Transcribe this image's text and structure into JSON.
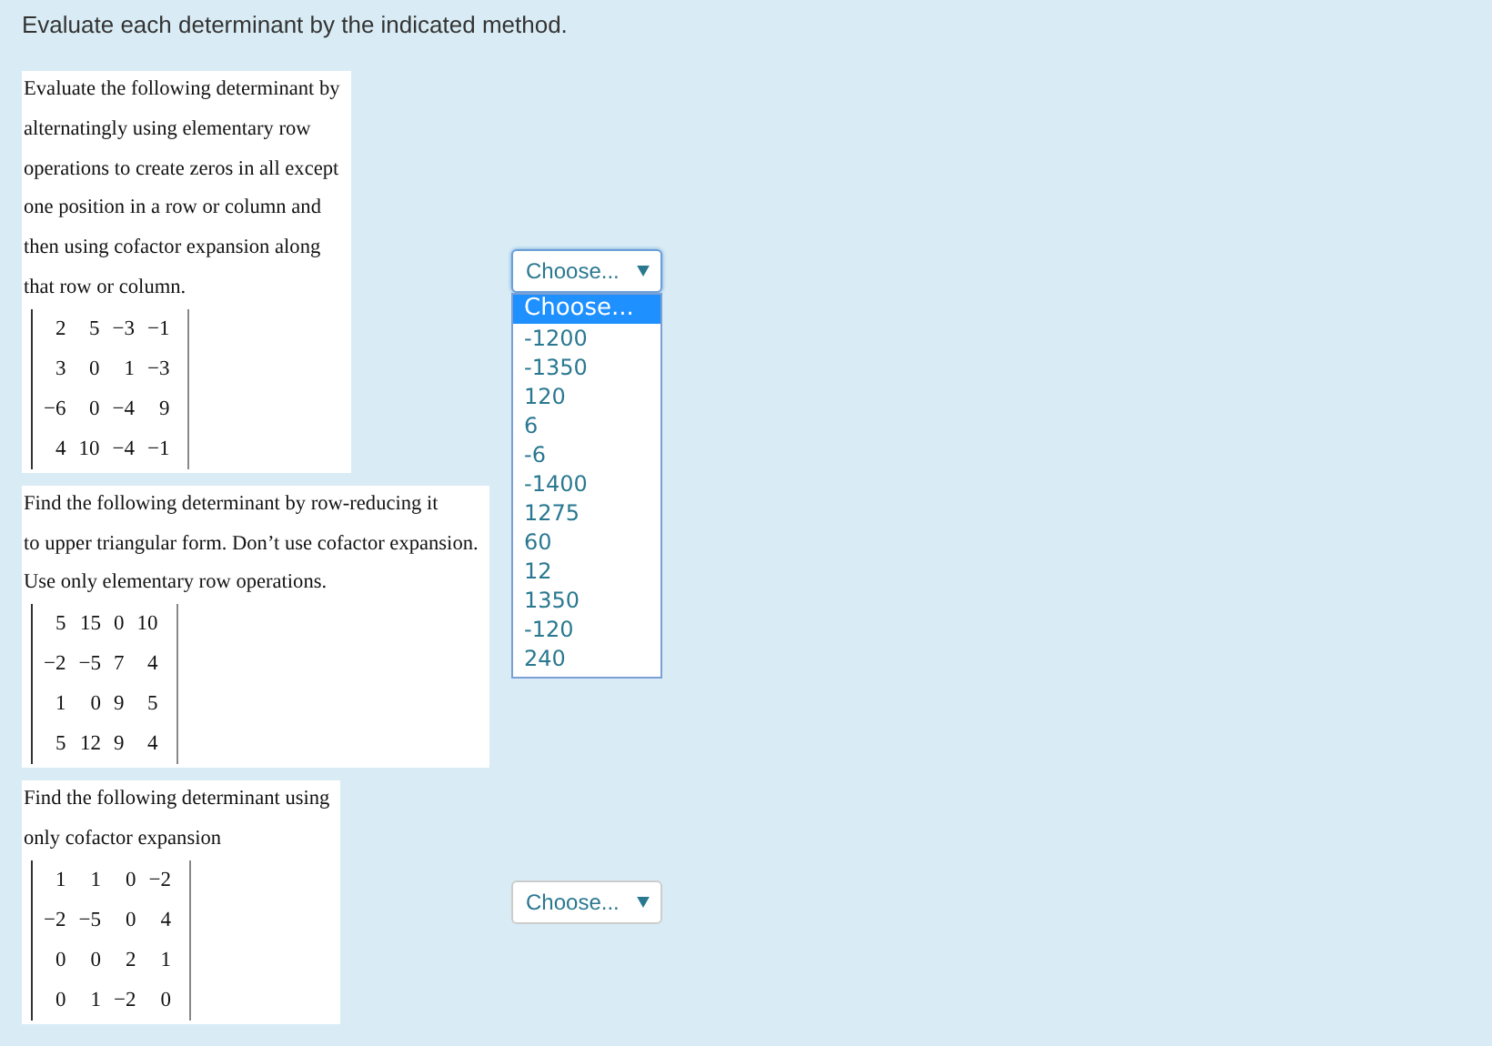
{
  "heading": "Evaluate each determinant by the indicated method.",
  "problems": [
    {
      "lines": [
        "Evaluate the following determinant by",
        "alternatingly using elementary row",
        "operations to create zeros in all except",
        "one position in a row or column and",
        "then using cofactor expansion along",
        "that row or column."
      ],
      "matrix": [
        [
          "2",
          "5",
          "−3",
          "−1"
        ],
        [
          "3",
          "0",
          "1",
          "−3"
        ],
        [
          "−6",
          "0",
          "−4",
          "9"
        ],
        [
          "4",
          "10",
          "−4",
          "−1"
        ]
      ],
      "dropdown": {
        "value": "Choose...",
        "expanded": true,
        "options": [
          {
            "label": "Choose...",
            "selected": true
          },
          {
            "label": "-1200",
            "selected": false
          },
          {
            "label": "-1350",
            "selected": false
          },
          {
            "label": "120",
            "selected": false
          },
          {
            "label": "6",
            "selected": false
          },
          {
            "label": "-6",
            "selected": false
          },
          {
            "label": "-1400",
            "selected": false
          },
          {
            "label": "1275",
            "selected": false
          },
          {
            "label": "60",
            "selected": false
          },
          {
            "label": "12",
            "selected": false
          },
          {
            "label": "1350",
            "selected": false
          },
          {
            "label": "-120",
            "selected": false
          },
          {
            "label": "240",
            "selected": false
          }
        ]
      }
    },
    {
      "lines": [
        "Find the following determinant by row-reducing it",
        "to upper triangular form. Don’t use cofactor expansion.",
        "Use only elementary row operations."
      ],
      "matrix": [
        [
          "5",
          "15",
          "0",
          "10"
        ],
        [
          "−2",
          "−5",
          "7",
          "4"
        ],
        [
          "1",
          "0",
          "9",
          "5"
        ],
        [
          "5",
          "12",
          "9",
          "4"
        ]
      ]
    },
    {
      "lines": [
        "Find the following determinant using",
        "only cofactor expansion"
      ],
      "matrix": [
        [
          "1",
          "1",
          "0",
          "−2"
        ],
        [
          "−2",
          "−5",
          "0",
          "4"
        ],
        [
          "0",
          "0",
          "2",
          "1"
        ],
        [
          "0",
          "1",
          "−2",
          "0"
        ]
      ],
      "dropdown": {
        "value": "Choose...",
        "expanded": false
      }
    }
  ]
}
